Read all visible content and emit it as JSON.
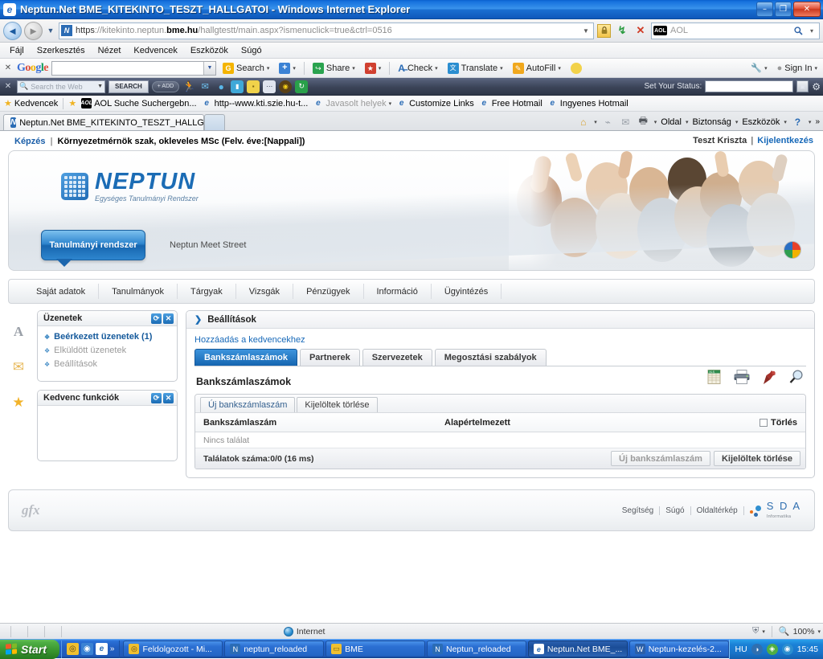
{
  "window": {
    "title": "Neptun.Net BME_KITEKINTO_TESZT_HALLGATOI - Windows Internet Explorer",
    "icon": "ie-icon",
    "minimize": "–",
    "maximize": "❐",
    "close": "✕"
  },
  "navbar": {
    "back_icon": "back-arrow-icon",
    "back_glyph": "◄",
    "forward_glyph": "►",
    "history_glyph": "▼",
    "url_scheme": "https",
    "url_sep": "://",
    "url_host_dim": "kitekinto.neptun.",
    "url_host_bold": "bme.hu",
    "url_path": "/hallgtestt/main.aspx?ismenuclick=true&ctrl=0516",
    "url_dropdown": "▼",
    "lock_icon": "padlock-icon",
    "lock_glyph": "🔒",
    "refresh_glyph": "↯",
    "stop_glyph": "✕",
    "search_engine": "AOL",
    "search_badge": "AOL",
    "search_go_glyph": "🔍",
    "search_drop_glyph": "▾"
  },
  "menubar": {
    "items": [
      "Fájl",
      "Szerkesztés",
      "Nézet",
      "Kedvencek",
      "Eszközök",
      "Súgó"
    ]
  },
  "google_toolbar": {
    "close_glyph": "✕",
    "logo": [
      {
        "ch": "G",
        "cls": "b"
      },
      {
        "ch": "o",
        "cls": "r"
      },
      {
        "ch": "o",
        "cls": "y"
      },
      {
        "ch": "g",
        "cls": "b"
      },
      {
        "ch": "l",
        "cls": "g"
      },
      {
        "ch": "e",
        "cls": "r"
      }
    ],
    "input_value": "",
    "input_caret": "▼",
    "buttons": [
      {
        "label": "Search",
        "icon": "google-search-icon",
        "color": "#f4b400",
        "glyph": "G",
        "caret": "▾"
      },
      {
        "label": "",
        "icon": "plus-icon",
        "color": "#3b82d4",
        "glyph": "+",
        "caret": "▾"
      },
      {
        "label": "Share",
        "icon": "share-icon",
        "color": "#2aa34f",
        "glyph": "↪",
        "caret": "▾"
      },
      {
        "label": "",
        "icon": "bookmark-icon",
        "color": "#d04030",
        "glyph": "★",
        "caret": "▾"
      },
      {
        "label": "Check",
        "icon": "spellcheck-icon",
        "color": "#2b6cb5",
        "glyph": "A",
        "caret": "▾"
      },
      {
        "label": "Translate",
        "icon": "translate-icon",
        "color": "#2b8ed0",
        "glyph": "文",
        "caret": "▾"
      },
      {
        "label": "AutoFill",
        "icon": "autofill-icon",
        "color": "#f0a81e",
        "glyph": "✎",
        "caret": "▾"
      },
      {
        "label": "",
        "icon": "highlighter-icon",
        "color": "#f2d24a",
        "glyph": "⬮",
        "caret": ""
      }
    ],
    "right_icons": [
      {
        "icon": "wrench-icon",
        "glyph": "🔧",
        "caret": "▾"
      },
      {
        "icon": "signin-icon",
        "glyph": "●",
        "label": "Sign In",
        "caret": "▾"
      }
    ]
  },
  "aol_toolbar": {
    "close_glyph": "✕",
    "search_icon": "magnifier-icon",
    "search_placeholder": "Search the Web",
    "search_caret": "▼",
    "search_button": "SEARCH",
    "add_button": "+ ADD",
    "icons": [
      {
        "name": "aol-running-man-icon",
        "glyph": "🏃",
        "color": "transparent"
      },
      {
        "name": "aol-mail-icon",
        "glyph": "✉",
        "color": "transparent"
      },
      {
        "name": "aol-chat-icon",
        "glyph": "●",
        "color": "transparent"
      },
      {
        "name": "aol-buddy-icon",
        "glyph": "▮",
        "color": "transparent"
      },
      {
        "name": "aol-notes-icon",
        "glyph": "▪",
        "color": "transparent"
      },
      {
        "name": "aol-dots-icon",
        "glyph": "⋯",
        "color": "transparent"
      },
      {
        "name": "aol-radio-icon",
        "glyph": "◉",
        "color": "transparent"
      },
      {
        "name": "aol-refresh-icon",
        "glyph": "↻",
        "color": "#29a04a"
      }
    ],
    "status_label": "Set Your Status:",
    "status_value": "",
    "status_btn_glyph": "▣",
    "gear_glyph": "⚙"
  },
  "favorites_bar": {
    "label": "Kedvencek",
    "star_icon": "star-icon",
    "items": [
      {
        "label": "AOL Suche Suchergebn...",
        "icon": "aol-icon",
        "dim": false
      },
      {
        "label": "http--www.kti.szie.hu-t...",
        "icon": "ie-icon",
        "dim": false
      },
      {
        "label": "Javasolt helyek",
        "icon": "ie-icon",
        "dim": true,
        "caret": "▾"
      },
      {
        "label": "Customize Links",
        "icon": "ie-icon",
        "dim": false
      },
      {
        "label": "Free Hotmail",
        "icon": "ie-icon",
        "dim": false
      },
      {
        "label": "Ingyenes Hotmail",
        "icon": "ie-icon",
        "dim": false
      }
    ]
  },
  "tabbar": {
    "tab_label": "Neptun.Net BME_KITEKINTO_TESZT_HALLGA...",
    "tab_icon": "neptun-icon",
    "newtab_glyph": "",
    "right_items": [
      {
        "name": "home-icon",
        "glyph": "⌂",
        "caret": "▾"
      },
      {
        "name": "feeds-icon",
        "glyph": "⌁",
        "caret": ""
      },
      {
        "name": "mail-icon",
        "glyph": "✉",
        "caret": ""
      },
      {
        "name": "print-icon",
        "glyph": "🖶",
        "caret": "▾"
      },
      {
        "name": "page-menu",
        "glyph": "",
        "label": "Oldal",
        "caret": "▾"
      },
      {
        "name": "safety-menu",
        "glyph": "",
        "label": "Biztonság",
        "caret": "▾"
      },
      {
        "name": "tools-menu",
        "glyph": "",
        "label": "Eszközök",
        "caret": "▾"
      },
      {
        "name": "help-menu",
        "glyph": "?",
        "label": "",
        "caret": "▾"
      }
    ],
    "overflow_glyph": "»"
  },
  "page": {
    "header": {
      "kepzes_label": "Képzés",
      "separator": "|",
      "program": "Környezetmérnök szak, okleveles MSc (Felv. éve:[Nappali])",
      "user": "Teszt Kriszta",
      "user_sep": "|",
      "logout": "Kijelentkezés"
    },
    "brand": {
      "name": "NEPTUN",
      "tagline": "Egységes Tanulmányi Rendszer",
      "logo_icon": "neptun-grid-logo"
    },
    "banner_tabs": {
      "primary": "Tanulmányi rendszer",
      "secondary": "Neptun Meet Street",
      "rainbow_icon": "color-wheel-icon"
    },
    "menu": [
      "Saját adatok",
      "Tanulmányok",
      "Tárgyak",
      "Vizsgák",
      "Pénzügyek",
      "Információ",
      "Ügyintézés"
    ],
    "left_rail": [
      {
        "name": "font-size-icon",
        "glyph": "A"
      },
      {
        "name": "mail-icon",
        "glyph": "✉"
      },
      {
        "name": "favorites-star-icon",
        "glyph": "★"
      }
    ],
    "panels": [
      {
        "title": "Üzenetek",
        "refresh_glyph": "⟳",
        "close_glyph": "✕",
        "links": [
          {
            "label": "Beérkezett üzenetek (1)",
            "state": "active"
          },
          {
            "label": "Elküldött üzenetek",
            "state": "muted"
          },
          {
            "label": "Beállítások",
            "state": "muted"
          }
        ]
      },
      {
        "title": "Kedvenc funkciók",
        "refresh_glyph": "⟳",
        "close_glyph": "✕",
        "links": []
      }
    ],
    "main": {
      "title": "Beállítások",
      "arrow_icon": "chevron-right-icon",
      "add_favorite": "Hozzáadás a kedvencekhez",
      "tabs": [
        {
          "label": "Bankszámlaszámok",
          "active": true
        },
        {
          "label": "Partnerek",
          "active": false
        },
        {
          "label": "Szervezetek",
          "active": false
        },
        {
          "label": "Megosztási szabályok",
          "active": false
        }
      ],
      "section_title": "Bankszámlaszámok",
      "tool_icons": [
        {
          "name": "excel-export-icon",
          "glyph": "▦"
        },
        {
          "name": "print-icon",
          "glyph": "🖶"
        },
        {
          "name": "pin-icon",
          "glyph": "📌"
        },
        {
          "name": "magnifier-icon",
          "glyph": "🔍"
        }
      ],
      "grid": {
        "toolbar_buttons": [
          {
            "label": "Új bankszámlaszám"
          },
          {
            "label": "Kijelöltek törlése"
          }
        ],
        "columns": [
          "Bankszámlaszám",
          "Alapértelmezett",
          "Törlés"
        ],
        "empty_text": "Nincs találat",
        "footer_text": "Találatok száma:0/0 (16 ms)",
        "footer_buttons": [
          {
            "label": "Új bankszámlaszám",
            "muted": true
          },
          {
            "label": "Kijelöltek törlése",
            "muted": false
          }
        ]
      }
    },
    "footer": {
      "gfx_logo": "gfx",
      "links": [
        "Segítség",
        "Súgó",
        "Oldaltérkép"
      ],
      "sda_name": "S D A",
      "sda_sub": "Informatika"
    }
  },
  "statusbar": {
    "zone": "Internet",
    "zone_icon": "globe-icon",
    "protect_icon": "protected-mode-icon",
    "protect_glyph": "⛨",
    "protect_caret": "▾",
    "zoom_icon": "zoom-icon",
    "zoom": "100%",
    "zoom_caret": "▾"
  },
  "taskbar": {
    "start": "Start",
    "start_icon": "windows-flag-icon",
    "quick_launch": [
      {
        "name": "aol-icon",
        "glyph": "◎",
        "color": "#f0c030"
      },
      {
        "name": "messenger-icon",
        "glyph": "◉",
        "color": "#3b82d4"
      },
      {
        "name": "ie-icon",
        "glyph": "e",
        "color": "#2b6cb5"
      }
    ],
    "quick_overflow": "»",
    "tasks": [
      {
        "label": "Feldolgozott - Mi...",
        "icon": "aol-icon",
        "color": "#f0c030",
        "glyph": "◎",
        "active": false
      },
      {
        "label": "neptun_reloaded",
        "icon": "neptun-icon",
        "color": "#2b6cb5",
        "glyph": "N",
        "active": false
      },
      {
        "label": "BME",
        "icon": "folder-icon",
        "color": "#f0c030",
        "glyph": "▭",
        "active": false
      },
      {
        "label": "Neptun_reloaded",
        "icon": "neptun-icon",
        "color": "#2b6cb5",
        "glyph": "N",
        "active": false
      },
      {
        "label": "Neptun.Net BME_...",
        "icon": "ie-icon",
        "color": "#2b6cb5",
        "glyph": "e",
        "active": true
      },
      {
        "label": "Neptun-kezelés-2...",
        "icon": "word-icon",
        "color": "#2b5fa8",
        "glyph": "W",
        "active": false
      }
    ],
    "tray": {
      "language": "HU",
      "icons": [
        {
          "name": "messenger-tray-icon",
          "glyph": "◑",
          "color": "#3b82d4"
        },
        {
          "name": "shield-tray-icon",
          "glyph": "◈",
          "color": "#4fae44"
        },
        {
          "name": "network-tray-icon",
          "glyph": "◉",
          "color": "#2b8ed0"
        }
      ],
      "clock": "15:45"
    }
  }
}
